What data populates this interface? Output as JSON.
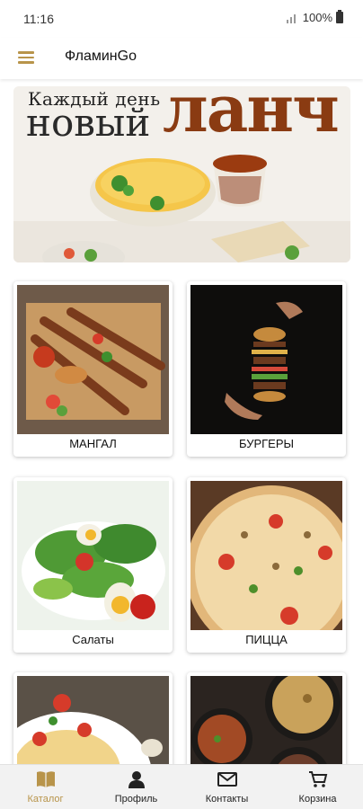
{
  "status_bar": {
    "time": "11:16",
    "battery": "100%"
  },
  "app_bar": {
    "title": "ФламинGo"
  },
  "banner": {
    "line1": "Каждый день",
    "line2": "новый",
    "line3": "ланч"
  },
  "categories": [
    {
      "label": "МАНГАЛ"
    },
    {
      "label": "БУРГЕРЫ"
    },
    {
      "label": "Салаты"
    },
    {
      "label": "ПИЦЦА"
    },
    {
      "label": ""
    },
    {
      "label": ""
    }
  ],
  "bottom_nav": {
    "items": [
      {
        "label": "Каталог",
        "icon": "book-icon",
        "active": true
      },
      {
        "label": "Профиль",
        "icon": "person-icon",
        "active": false
      },
      {
        "label": "Контакты",
        "icon": "envelope-icon",
        "active": false
      },
      {
        "label": "Корзина",
        "icon": "cart-icon",
        "active": false
      }
    ]
  },
  "colors": {
    "accent": "#b8944a",
    "nav_background": "#f2f2f2"
  }
}
